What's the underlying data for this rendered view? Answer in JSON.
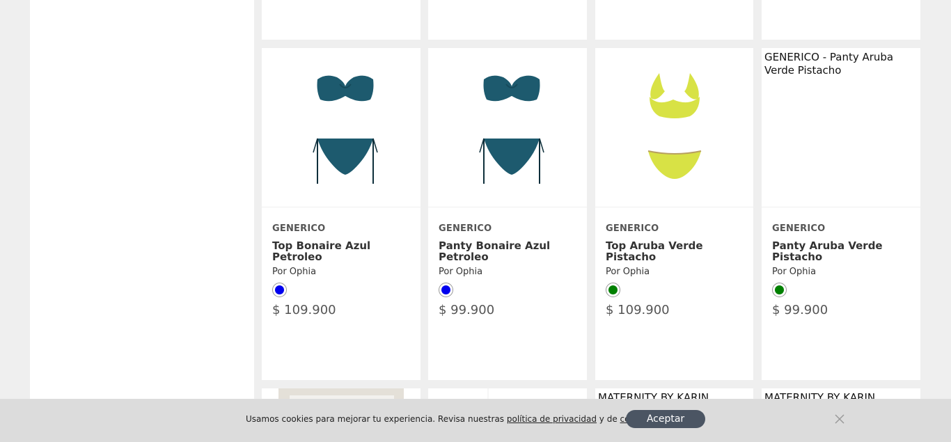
{
  "products": [
    {
      "brand": "GENERICO",
      "name": "Top Bonaire Azul Petroleo",
      "seller": "Por Ophia",
      "color": "#0000ee",
      "price": "$ 109.900",
      "image": "teal-bikini"
    },
    {
      "brand": "GENERICO",
      "name": "Panty Bonaire Azul Petroleo",
      "seller": "Por Ophia",
      "color": "#0000ee",
      "price": "$ 99.900",
      "image": "teal-bikini"
    },
    {
      "brand": "GENERICO",
      "name": "Top Aruba Verde Pistacho",
      "seller": "Por Ophia",
      "color": "#008000",
      "price": "$ 109.900",
      "image": "lime-bikini"
    },
    {
      "brand": "GENERICO",
      "name": "Panty Aruba Verde Pistacho",
      "seller": "Por Ophia",
      "color": "#008000",
      "price": "$ 99.900",
      "image_alt": "GENERICO - Panty Aruba Verde Pistacho"
    }
  ],
  "bottom_row": {
    "col3_title": "MATERNITY BY KARIN",
    "col4_title": "MATERNITY BY KARIN"
  },
  "cookie": {
    "text_before": "Usamos cookies para mejorar tu experiencia. Revisa nuestras ",
    "privacy_link": "política de privacidad",
    "text_middle": " y de ",
    "cookies_link": "cookies",
    "text_end": ".",
    "accept_label": "Aceptar",
    "close_icon": "close-icon"
  }
}
